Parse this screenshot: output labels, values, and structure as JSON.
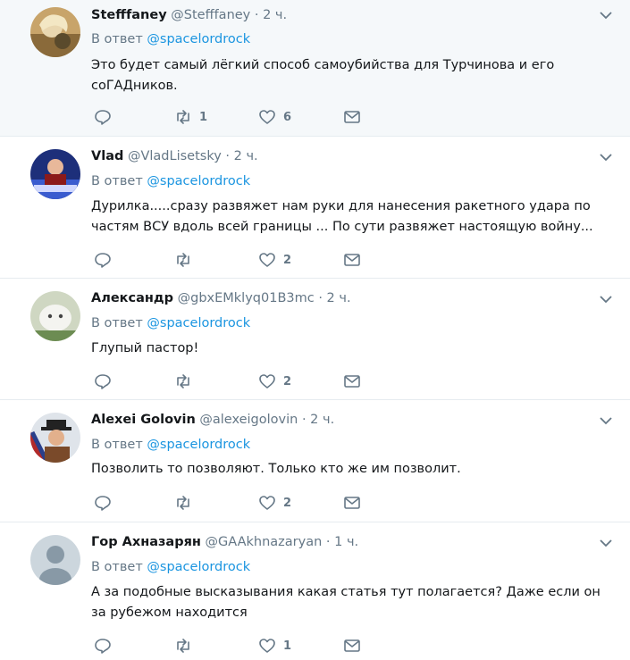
{
  "reply_prefix": "В ответ",
  "icons": {
    "reply": "reply-icon",
    "retweet": "retweet-icon",
    "like": "heart-icon",
    "dm": "envelope-icon",
    "more": "chevron-down-icon"
  },
  "colors": {
    "link": "#1b95e0",
    "secondary": "#657786",
    "highlight_bg": "#f5f8fa"
  },
  "tweets": [
    {
      "name": "Stefffaney",
      "handle": "@Stefffaney",
      "time": "2 ч.",
      "reply_to": "@spacelordrock",
      "text": "Это будет самый лёгкий способ самоубийства для Турчинова и его соГАДников.",
      "retweets": "1",
      "likes": "6"
    },
    {
      "name": "Vlad",
      "handle": "@VladLisetsky",
      "time": "2 ч.",
      "reply_to": "@spacelordrock",
      "text": "Дурилка.....сразу развяжет нам руки для нанесения ракетного удара по частям ВСУ вдоль всей границы ... По сути развяжет настоящую войну...",
      "retweets": "",
      "likes": "2"
    },
    {
      "name": "Александр",
      "handle": "@gbxEMklyq01B3mc",
      "time": "2 ч.",
      "reply_to": "@spacelordrock",
      "text": "Глупый пастор!",
      "retweets": "",
      "likes": "2"
    },
    {
      "name": "Alexei Golovin",
      "handle": "@alexeigolovin",
      "time": "2 ч.",
      "reply_to": "@spacelordrock",
      "text": "Позволить то позволяют. Только кто же им позволит.",
      "retweets": "",
      "likes": "2"
    },
    {
      "name": "Гор Ахназарян",
      "handle": "@GAAkhnazaryan",
      "time": "1 ч.",
      "reply_to": "@spacelordrock",
      "text": "А за подобные высказывания какая статья тут полагается? Даже если он за рубежом находится",
      "retweets": "",
      "likes": "1"
    }
  ]
}
